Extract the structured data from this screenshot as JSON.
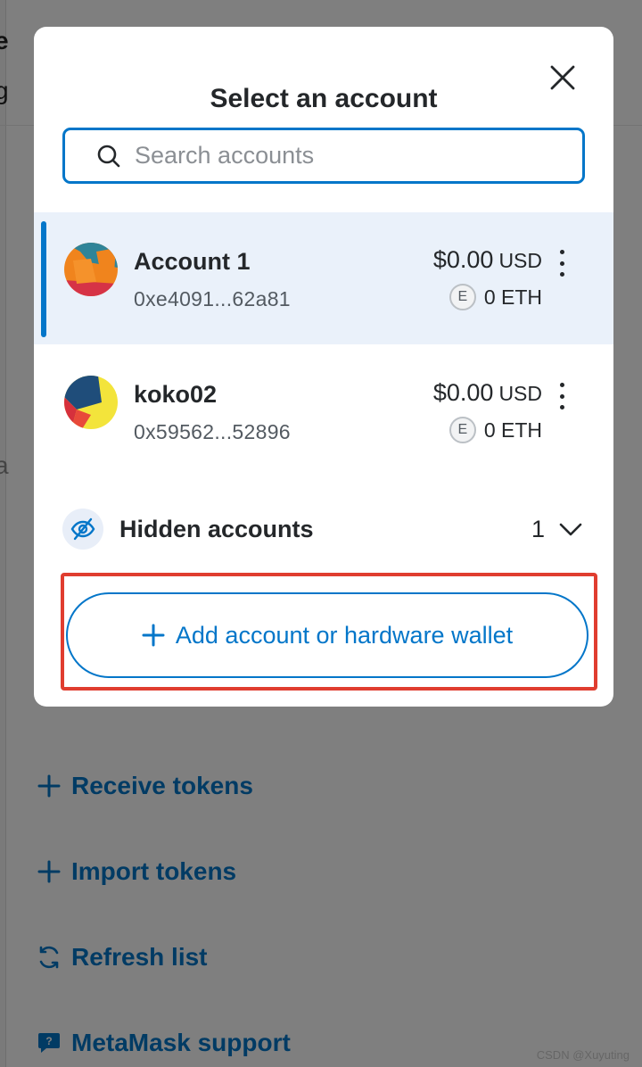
{
  "modal": {
    "title": "Select an account",
    "search": {
      "placeholder": "Search accounts",
      "value": ""
    },
    "accounts": [
      {
        "name": "Account 1",
        "address": "0xe4091...62a81",
        "balance": "$0.00",
        "currency": "USD",
        "token_badge": "E",
        "token_amount": "0 ETH",
        "selected": true
      },
      {
        "name": "koko02",
        "address": "0x59562...52896",
        "balance": "$0.00",
        "currency": "USD",
        "token_badge": "E",
        "token_amount": "0 ETH",
        "selected": false
      }
    ],
    "hidden_accounts": {
      "label": "Hidden accounts",
      "count": "1"
    },
    "add_button": {
      "label": "Add account or hardware wallet"
    }
  },
  "background": {
    "partial_texts": [
      "e",
      "g",
      "a"
    ],
    "actions": [
      {
        "label": "Receive tokens",
        "icon": "plus-icon"
      },
      {
        "label": "Import tokens",
        "icon": "plus-icon"
      },
      {
        "label": "Refresh list",
        "icon": "refresh-icon"
      },
      {
        "label": "MetaMask support",
        "icon": "chat-icon"
      }
    ]
  },
  "watermark": "CSDN @Xuyuting",
  "colors": {
    "accent": "#0376c9",
    "highlight_border": "#e03d2f",
    "selected_row": "#eaf1fa",
    "text": "#24272a"
  }
}
